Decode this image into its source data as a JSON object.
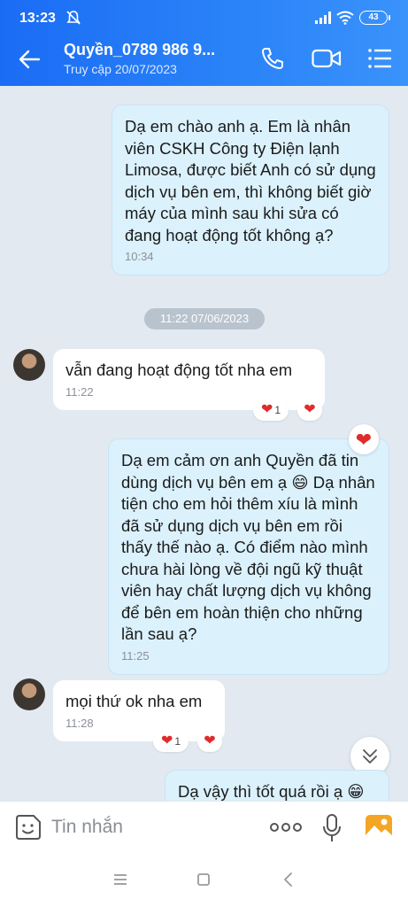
{
  "status": {
    "time": "13:23",
    "battery": "43"
  },
  "header": {
    "name": "Quyền_0789 986 9...",
    "subtitle": "Truy cập 20/07/2023"
  },
  "messages": {
    "m1": {
      "text": "Dạ em chào anh ạ. Em là nhân viên CSKH Công ty Điện lạnh Limosa, được biết Anh có sử dụng dịch vụ bên em, thì không biết giờ máy của mình sau khi sửa có đang hoạt động tốt không ạ?",
      "time": "10:34"
    },
    "date_chip": "11:22 07/06/2023",
    "m2": {
      "text": "vẫn đang hoạt động tốt nha em",
      "time": "11:22",
      "reaction_count": "1"
    },
    "m3": {
      "text": "Dạ em cảm ơn anh Quyền đã tin dùng dịch vụ bên em ạ 😄  Dạ nhân tiện cho em hỏi thêm xíu là mình đã sử dụng dịch vụ bên em rồi thấy thế nào ạ. Có điểm nào mình chưa hài lòng về đội ngũ kỹ thuật viên hay chất lượng dịch vụ không để bên em hoàn thiện cho những lần sau ạ?",
      "time": "11:25"
    },
    "m4": {
      "text": "mọi thứ ok nha em",
      "time": "11:28",
      "reaction_count": "1"
    },
    "m5": {
      "text": "Dạ vậy thì tốt quá rồi ạ 😁"
    }
  },
  "input": {
    "placeholder": "Tin nhắn"
  },
  "icons": [
    "back-arrow-icon",
    "phone-icon",
    "video-call-icon",
    "menu-icon",
    "heart-icon",
    "chevron-down-icon",
    "sticker-icon",
    "more-icon",
    "microphone-icon",
    "image-icon"
  ],
  "colors": {
    "header": "#1a6cf5",
    "outgoing_bubble": "#dbf1fc",
    "background": "#e2e9f1",
    "heart": "#e02b2b"
  }
}
